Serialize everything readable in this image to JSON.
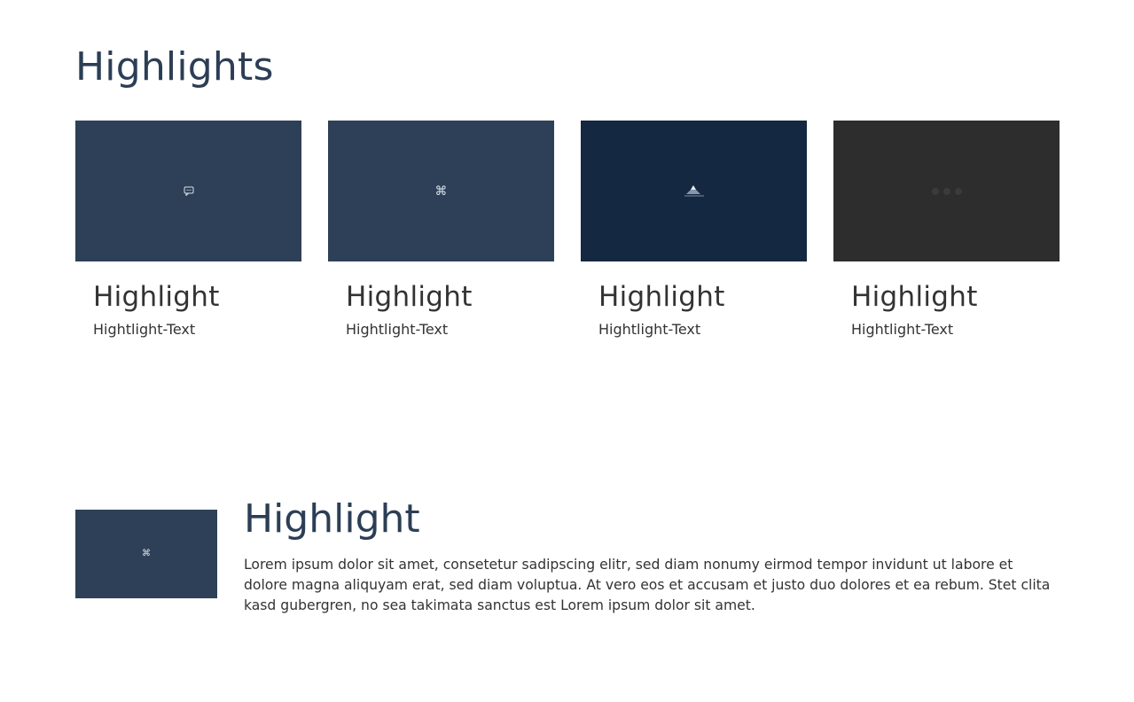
{
  "section": {
    "title": "Highlights"
  },
  "cards": [
    {
      "title": "Highlight",
      "text": "Hightlight-Text",
      "icon": "chat-bubble-icon",
      "bg": "#2e4057"
    },
    {
      "title": "Highlight",
      "text": "Hightlight-Text",
      "icon": "command-icon",
      "bg": "#2e4057",
      "glyph": "⌘"
    },
    {
      "title": "Highlight",
      "text": "Hightlight-Text",
      "icon": "mountain-icon",
      "bg": "#152841"
    },
    {
      "title": "Highlight",
      "text": "Hightlight-Text",
      "icon": "more-dots-icon",
      "bg": "#2d2d2d"
    }
  ],
  "feature": {
    "title": "Highlight",
    "text": "Lorem ipsum dolor sit amet, consetetur sadipscing elitr, sed diam nonumy eirmod tempor invidunt ut labore et dolore magna aliquyam erat, sed diam voluptua. At vero eos et accusam et justo duo dolores et ea rebum. Stet clita kasd gubergren, no sea takimata sanctus est Lorem ipsum dolor sit amet.",
    "icon": "command-icon",
    "glyph": "⌘",
    "bg": "#2e4057"
  }
}
